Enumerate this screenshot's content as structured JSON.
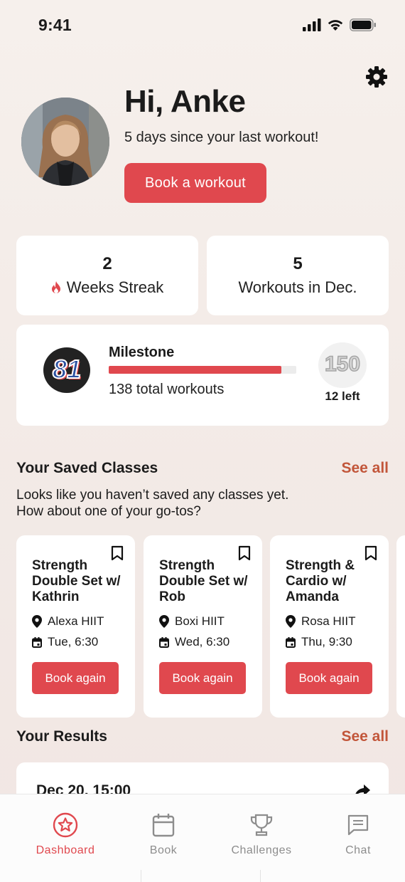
{
  "status_bar": {
    "time": "9:41"
  },
  "profile": {
    "greeting": "Hi, Anke",
    "subtitle": "5 days since your last workout!",
    "book_button": "Book a workout"
  },
  "stats": [
    {
      "value": "2",
      "label": "Weeks Streak",
      "icon": "flame-icon"
    },
    {
      "value": "5",
      "label": "Workouts in Dec."
    }
  ],
  "milestone": {
    "title": "Milestone",
    "current_badge": "81",
    "target_badge": "150",
    "total": "138 total workouts",
    "left": "12 left",
    "progress": 0.92
  },
  "saved_classes": {
    "title": "Your Saved Classes",
    "see_all": "See all",
    "description": "Looks like you haven’t saved any classes yet. How about one of your go-tos?",
    "items": [
      {
        "title": "Strength Double Set w/ Kathrin",
        "location": "Alexa HIIT",
        "time": "Tue, 6:30",
        "button": "Book again"
      },
      {
        "title": "Strength Double Set w/ Rob",
        "location": "Boxi HIIT",
        "time": "Wed, 6:30",
        "button": "Book again"
      },
      {
        "title": "Strength & Cardio w/ Amanda",
        "location": "Rosa HIIT",
        "time": "Thu, 9:30",
        "button": "Book again"
      }
    ]
  },
  "results": {
    "title": "Your Results",
    "see_all": "See all",
    "first_item": "Dec 20, 15:00"
  },
  "tabs": [
    {
      "label": "Dashboard",
      "icon": "star-badge-icon",
      "active": true
    },
    {
      "label": "Book",
      "icon": "calendar-icon",
      "active": false
    },
    {
      "label": "Challenges",
      "icon": "trophy-icon",
      "active": false
    },
    {
      "label": "Chat",
      "icon": "chat-icon",
      "active": false
    }
  ],
  "colors": {
    "accent": "#e0484e",
    "link": "#c2563a",
    "background": "#f4ede9"
  }
}
